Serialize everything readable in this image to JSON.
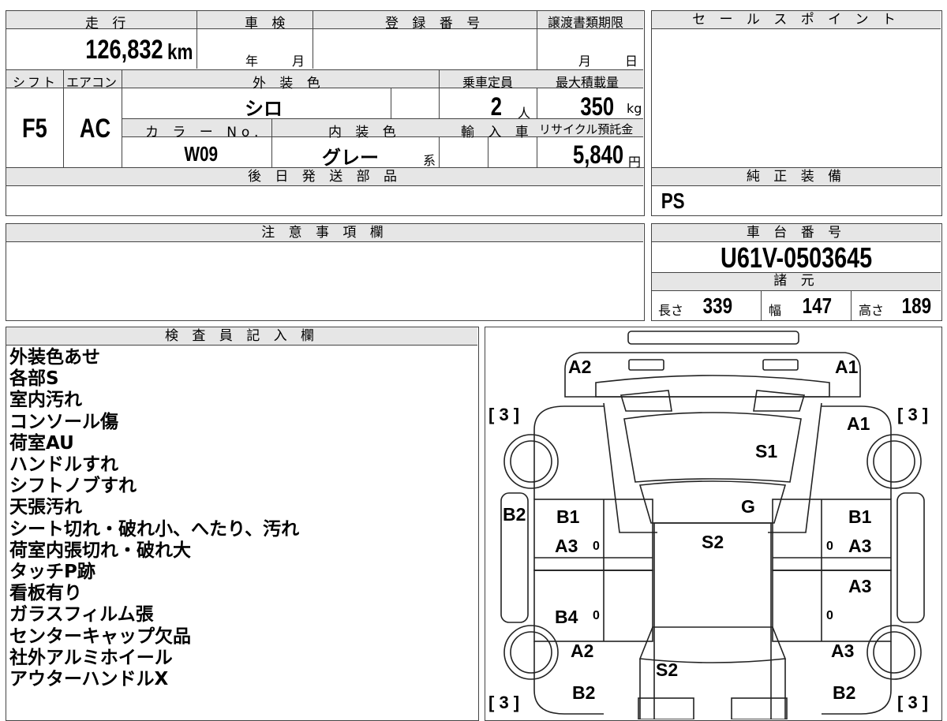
{
  "top_sheet": {
    "mileage_label": "走 行",
    "mileage_value": "126,832",
    "mileage_unit": "km",
    "shaken_label": "車 検",
    "shaken_year_unit": "年",
    "shaken_month_unit": "月",
    "registration_label": "登 録 番 号",
    "transfer_label": "譲渡書類期限",
    "transfer_month_unit": "月",
    "transfer_day_unit": "日",
    "shift_label": "シフト",
    "shift_value": "F5",
    "ac_label": "エアコン",
    "ac_value": "AC",
    "exterior_color_label": "外 装 色",
    "exterior_color_value": "シロ",
    "capacity_label": "乗車定員",
    "capacity_value": "2",
    "capacity_unit": "人",
    "max_load_label": "最大積載量",
    "max_load_value": "350",
    "max_load_unit": "kg",
    "color_no_label": "カ ラ ー No.",
    "color_no_value": "W09",
    "interior_color_label": "内 装 色",
    "interior_color_value": "グレー",
    "interior_color_suffix": "系",
    "import_label": "輸 入 車",
    "recycle_label": "リサイクル預託金",
    "recycle_value": "5,840",
    "recycle_unit": "円",
    "later_parts_label": "後 日 発 送 部 品",
    "sales_point_label": "セ ー ル ス ポ イ ン ト",
    "genuine_equipment_label": "純 正 装 備",
    "genuine_equipment_value": "PS",
    "caution_label": "注 意 事 項 欄",
    "chassis_label": "車 台 番 号",
    "chassis_value": "U61V-0503645",
    "specs_label": "諸 元",
    "length_label": "長さ",
    "length_value": "339",
    "width_label": "幅",
    "width_value": "147",
    "height_label": "高さ",
    "height_value": "189",
    "inspector_label": "検 査 員 記 入 欄"
  },
  "inspector_notes": [
    "外装色あせ",
    "各部S",
    "室内汚れ",
    "コンソール傷",
    "荷室AU",
    "ハンドルすれ",
    "シフトノブすれ",
    "天張汚れ",
    "シート切れ・破れ小、へたり、汚れ",
    "荷室内張切れ・破れ大",
    "タッチP跡",
    "看板有り",
    "ガラスフィルム張",
    "センターキャップ欠品",
    "社外アルミホイール",
    "アウターハンドルX"
  ],
  "diagram": {
    "tire_marks": [
      "[ 3 ]",
      "[ 3 ]",
      "[ 3 ]",
      "[ 3 ]"
    ],
    "damage_codes": [
      "A2",
      "A1",
      "A1",
      "S1",
      "G",
      "B2",
      "B1",
      "A3",
      "S2",
      "B1",
      "A3",
      "A3",
      "B4",
      "A2",
      "A3",
      "S2",
      "B2",
      "B2"
    ],
    "zero_marks": [
      "0",
      "0",
      "0",
      "0"
    ]
  }
}
